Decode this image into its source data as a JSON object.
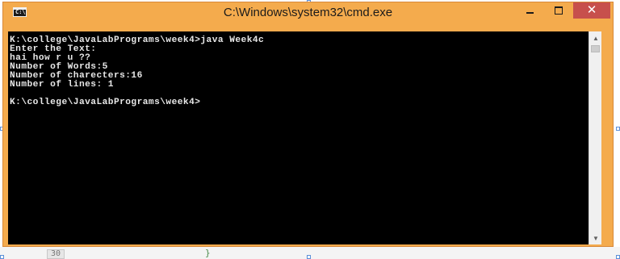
{
  "window": {
    "title": "C:\\Windows\\system32\\cmd.exe",
    "icon": "cmd-icon",
    "icon_text": "C:\\",
    "frame_color": "#f4ab4d",
    "close_color": "#c7504c",
    "minimize_symbol": "minimize-icon",
    "maximize_symbol": "maximize-icon",
    "close_symbol": "✕"
  },
  "console": {
    "background": "#000000",
    "text_color": "#e8e8e8",
    "lines": [
      "K:\\college\\JavaLabPrograms\\week4>java Week4c",
      "Enter the Text:",
      "hai how r u ??",
      "Number of Words:5",
      "Number of charecters:16",
      "Number of lines: 1",
      "",
      "K:\\college\\JavaLabPrograms\\week4>"
    ]
  },
  "scrollbar": {
    "up_arrow": "▲",
    "down_arrow": "▼"
  },
  "background_document": {
    "line_number": "30",
    "brace": "}"
  }
}
